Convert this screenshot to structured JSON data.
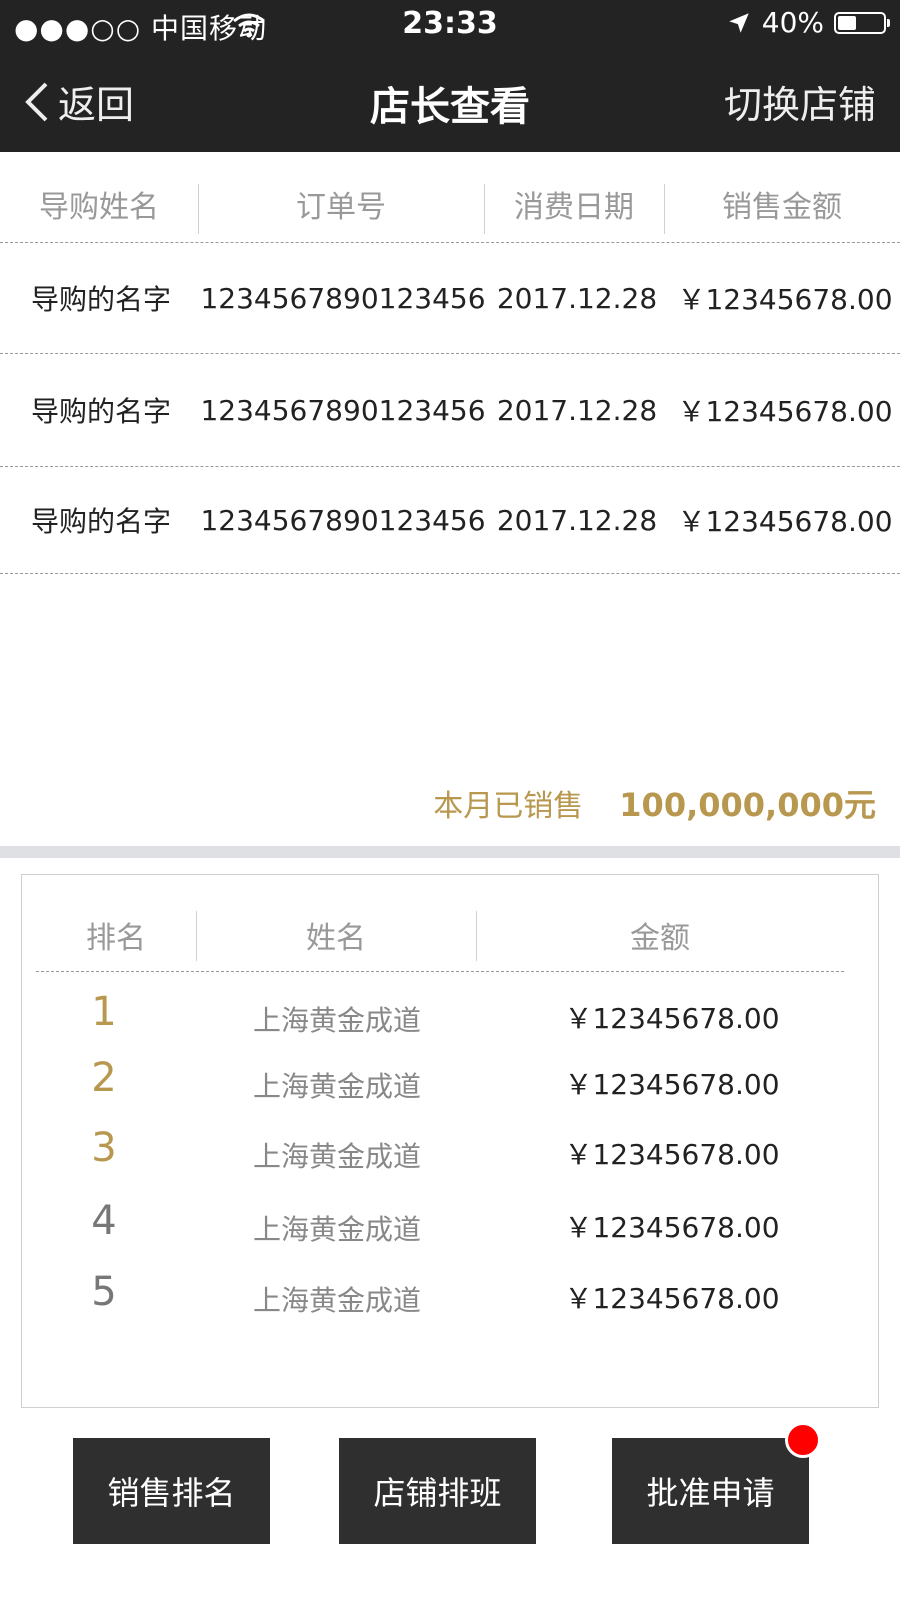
{
  "status_bar": {
    "carrier": "●●●○○ 中国移动",
    "time": "23:33",
    "battery": "40%",
    "battery_level": 0.4,
    "icons": [
      "wifi-icon",
      "location-arrow-icon",
      "battery-icon"
    ]
  },
  "nav": {
    "back_label": "返回",
    "title": "店长查看",
    "switch_label": "切换店铺"
  },
  "orders": {
    "headers": [
      "导购姓名",
      "订单号",
      "消费日期",
      "销售金额"
    ],
    "rows": [
      {
        "guide": "导购的名字",
        "order_no": "1234567890123456",
        "date": "2017.12.28",
        "amount": "￥12345678.00"
      },
      {
        "guide": "导购的名字",
        "order_no": "1234567890123456",
        "date": "2017.12.28",
        "amount": "￥12345678.00"
      },
      {
        "guide": "导购的名字",
        "order_no": "1234567890123456",
        "date": "2017.12.28",
        "amount": "￥12345678.00"
      }
    ]
  },
  "summary": {
    "label": "本月已销售",
    "value": "100,000,000元"
  },
  "ranking": {
    "headers": [
      "排名",
      "姓名",
      "金额"
    ],
    "rows": [
      {
        "rank": "1",
        "name": "上海黄金成道",
        "amount": "￥12345678.00"
      },
      {
        "rank": "2",
        "name": "上海黄金成道",
        "amount": "￥12345678.00"
      },
      {
        "rank": "3",
        "name": "上海黄金成道",
        "amount": "￥12345678.00"
      },
      {
        "rank": "4",
        "name": "上海黄金成道",
        "amount": "￥12345678.00"
      },
      {
        "rank": "5",
        "name": "上海黄金成道",
        "amount": "￥12345678.00"
      }
    ]
  },
  "buttons": {
    "sales_rank": "销售排名",
    "store_schedule": "店铺排班",
    "approve": "批准申请"
  },
  "colors": {
    "nav_bg": "#232323",
    "accent_gold": "#b8974f",
    "button_bg": "#2f2f2f",
    "badge_red": "#ff0000"
  }
}
